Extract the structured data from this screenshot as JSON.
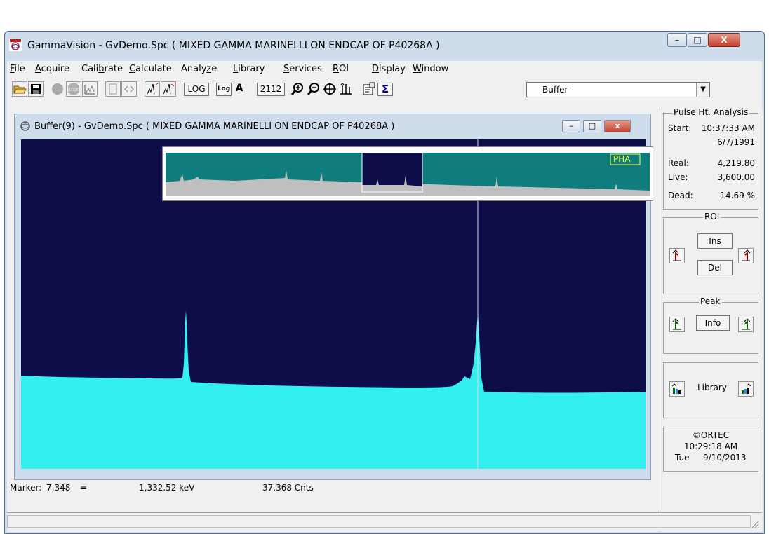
{
  "window": {
    "title": "GammaVision - GvDemo.Spc ( MIXED GAMMA MARINELLI ON ENDCAP OF P40268A )",
    "minimize_label": "–",
    "maximize_label": "□",
    "close_label": "X"
  },
  "menu": {
    "items": [
      {
        "label": "File",
        "underline": "F"
      },
      {
        "label": "Acquire",
        "underline": "A"
      },
      {
        "label": "Calibrate",
        "underline": "b"
      },
      {
        "label": "Calculate",
        "underline": "C"
      },
      {
        "label": "Analyze",
        "underline": "z"
      },
      {
        "label": "Library",
        "underline": "L"
      },
      {
        "label": "Services",
        "underline": "S"
      },
      {
        "label": "ROI",
        "underline": "R"
      },
      {
        "label": "Display",
        "underline": "D"
      },
      {
        "label": "Window",
        "underline": "W"
      }
    ]
  },
  "toolbar": {
    "log_button": "LOG",
    "log_toggle": "Log",
    "auto_button": "A",
    "width_value": "2112",
    "buffer_select": "Buffer",
    "sigma_label": "Σ"
  },
  "spectrum_window": {
    "title": "Buffer(9) - GvDemo.Spc ( MIXED GAMMA MARINELLI ON ENDCAP OF P40268A )",
    "overview_label": "PHA"
  },
  "marker": {
    "label": "Marker:",
    "channel": "7,348",
    "equals": "=",
    "energy": "1,332.52  keV",
    "counts": "37,368  Cnts"
  },
  "pha_panel": {
    "title": "Pulse Ht. Analysis",
    "start_label": "Start:",
    "start_time": "10:37:33 AM",
    "start_date": "6/7/1991",
    "real_label": "Real:",
    "real_value": "4,219.80",
    "live_label": "Live:",
    "live_value": "3,600.00",
    "dead_label": "Dead:",
    "dead_value": "14.69  %"
  },
  "roi_panel": {
    "title": "ROI",
    "ins_label": "Ins",
    "del_label": "Del"
  },
  "peak_panel": {
    "title": "Peak",
    "info_label": "Info"
  },
  "library_panel": {
    "label": "Library"
  },
  "clock_panel": {
    "brand": "©ORTEC",
    "time": "10:29:18 AM",
    "day": "Tue",
    "date": "9/10/2013"
  },
  "colors": {
    "spectrum_background": "#0d0d4a",
    "spectrum_fill": "#33f0f0",
    "overview_background": "#0f7d7d",
    "overview_fill": "#bfbfbf",
    "pha_label": "#ffff33"
  }
}
